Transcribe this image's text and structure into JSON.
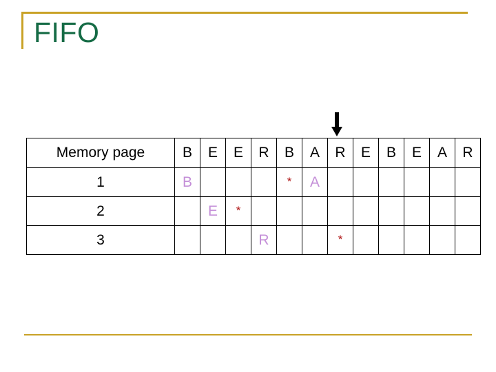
{
  "slide": {
    "title": "FIFO",
    "accent_color": "#C9A227",
    "title_color": "#156B45",
    "highlight_color": "#C48FD8",
    "marker_color": "#B01818",
    "background_color": "#FFFFFF"
  },
  "arrow": {
    "name": "down-arrow",
    "points_to_column_index": 6,
    "points_to_column_label": "R"
  },
  "table": {
    "row_label_header": "Memory page",
    "reference_string": [
      "B",
      "E",
      "E",
      "R",
      "B",
      "A",
      "R",
      "E",
      "B",
      "E",
      "A",
      "R"
    ],
    "rows": [
      {
        "label": "1",
        "cells": [
          "B",
          "",
          "",
          "",
          "*",
          "A",
          "",
          "",
          "",
          "",
          "",
          ""
        ]
      },
      {
        "label": "2",
        "cells": [
          "",
          "E",
          "*",
          "",
          "",
          "",
          "",
          "",
          "",
          "",
          "",
          ""
        ]
      },
      {
        "label": "3",
        "cells": [
          "",
          "",
          "",
          "R",
          "",
          "",
          "*",
          "",
          "",
          "",
          "",
          ""
        ]
      }
    ]
  }
}
